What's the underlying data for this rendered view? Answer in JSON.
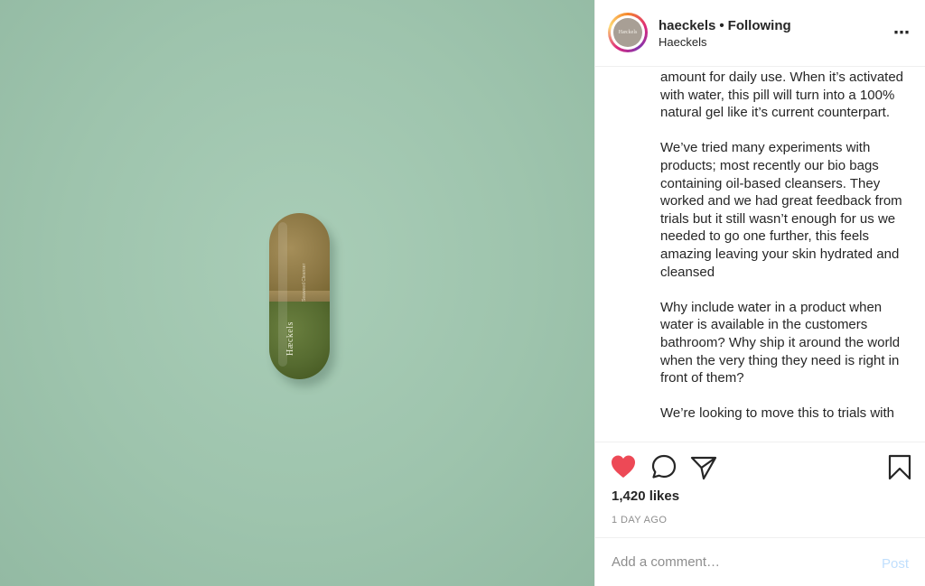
{
  "post": {
    "image_alt": "Haeckels capsule on green background",
    "capsule_brand": "Hæckels",
    "capsule_small_text": "Seaweed Cleanser"
  },
  "header": {
    "avatar_text": "Hæckels",
    "username": "haeckels",
    "separator": "•",
    "follow_status": "Following",
    "location": "Haeckels",
    "more_icon": "⋯"
  },
  "caption": {
    "text": "amount for daily use. When it’s activated with water, this pill will turn into a 100% natural gel like it’s current counterpart.\n\nWe’ve tried many experiments with products; most recently our bio bags containing oil-based cleansers. They worked and we had great feedback from trials but it still wasn’t enough for us we needed to go one further, this feels amazing leaving your skin hydrated and cleansed\n\nWhy include water in a product when water is available in the customers bathroom? Why ship it around the world when the very thing they need is right in front of them?\n\nWe’re looking to move this to trials with"
  },
  "actions": {
    "like_icon": "heart-filled-icon",
    "comment_icon": "comment-icon",
    "share_icon": "paper-plane-icon",
    "save_icon": "bookmark-icon",
    "like_color": "#ed4956"
  },
  "likes": "1,420 likes",
  "timestamp": "1 DAY AGO",
  "comment": {
    "placeholder": "Add a comment…",
    "post_label": "Post"
  }
}
